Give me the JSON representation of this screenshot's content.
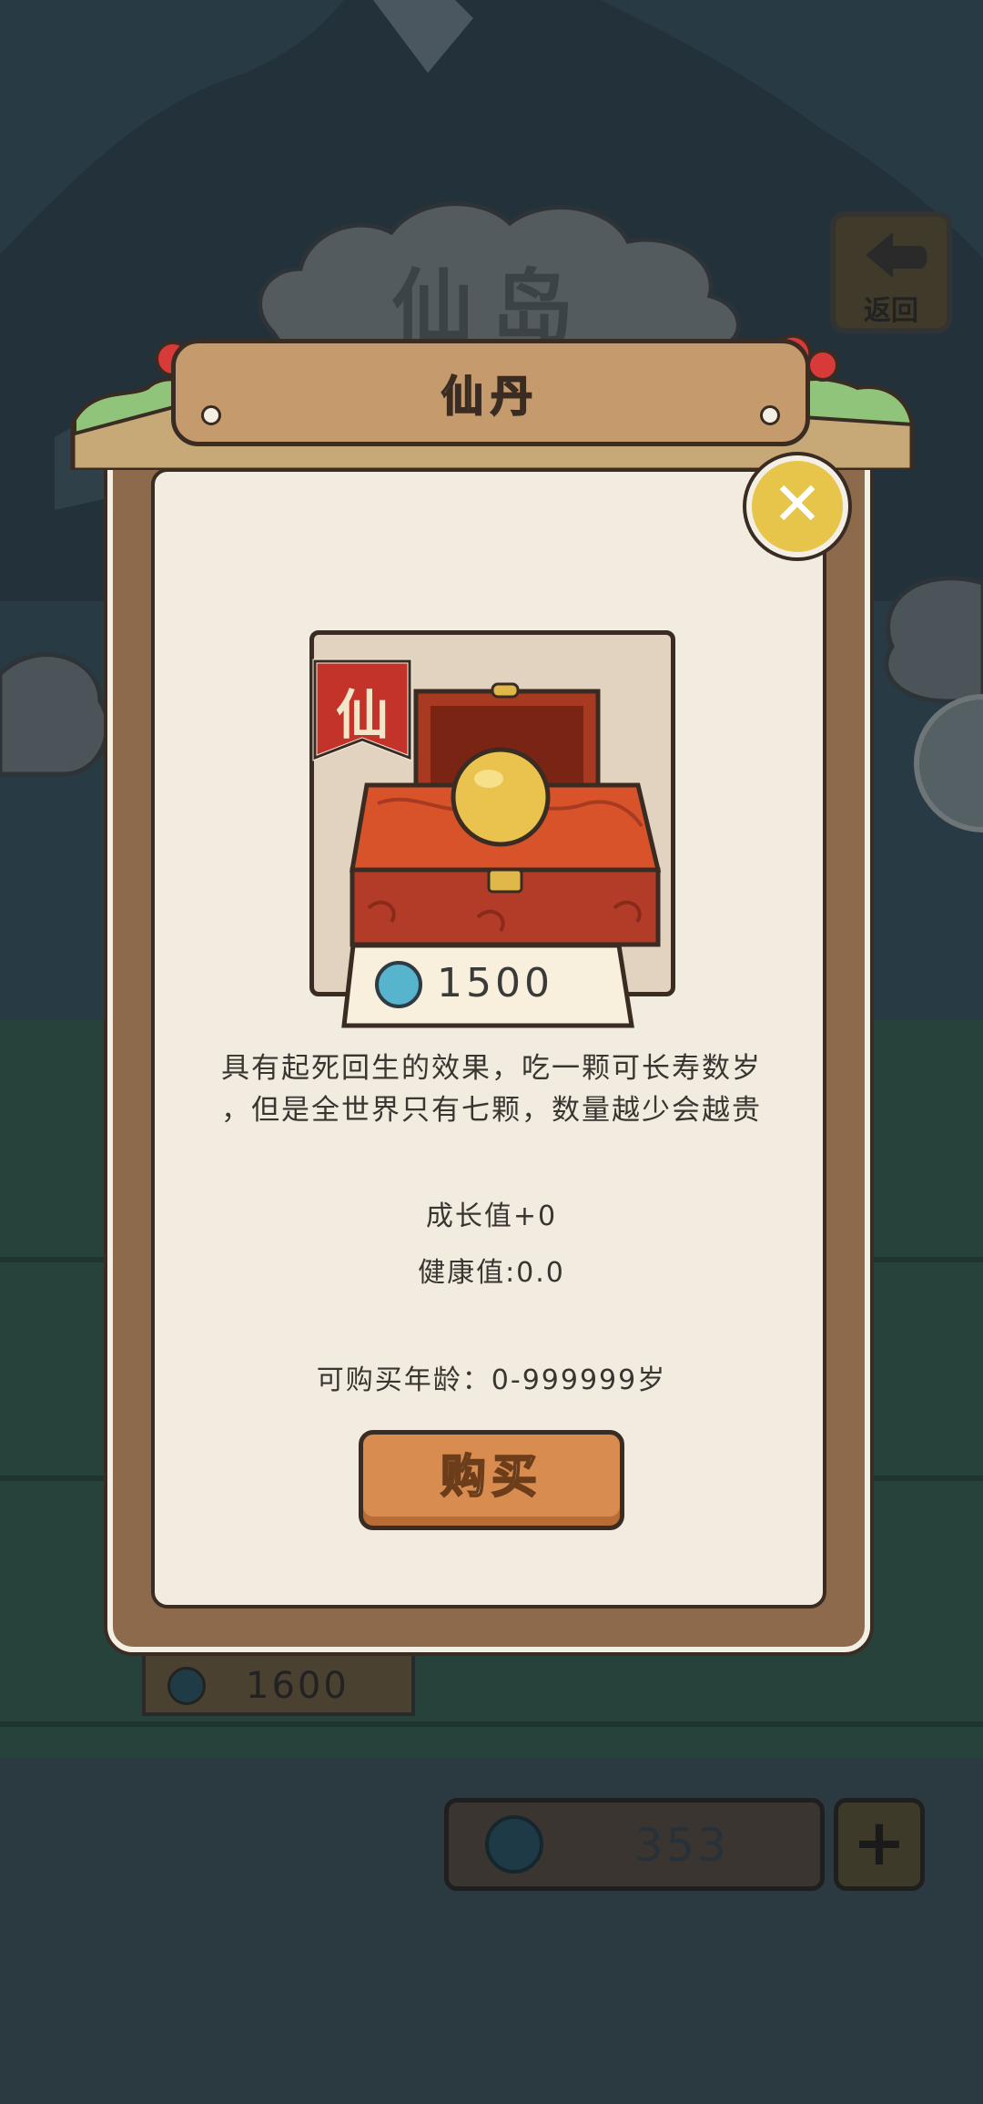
{
  "background": {
    "title": "仙岛",
    "back_label": "返回",
    "shelf_price": "1600",
    "coin_balance": "353",
    "add_coin_label": "+"
  },
  "dialog": {
    "title": "仙丹",
    "close_label": "✕",
    "item": {
      "badge": "仙",
      "price": "1500",
      "description_line1": "具有起死回生的效果，吃一颗可长寿数岁",
      "description_line2": "，但是全世界只有七颗，数量越少会越贵",
      "growth": "成长值+0",
      "health": "健康值:0.0",
      "age_range": "可购买年龄：0-999999岁"
    },
    "buy_label": "购买"
  },
  "colors": {
    "wood": "#8e6a4d",
    "parchment": "#f1ecdf",
    "button_orange": "#d98c4f",
    "close_yellow": "#e6c54a",
    "badge_red": "#c4332a"
  }
}
